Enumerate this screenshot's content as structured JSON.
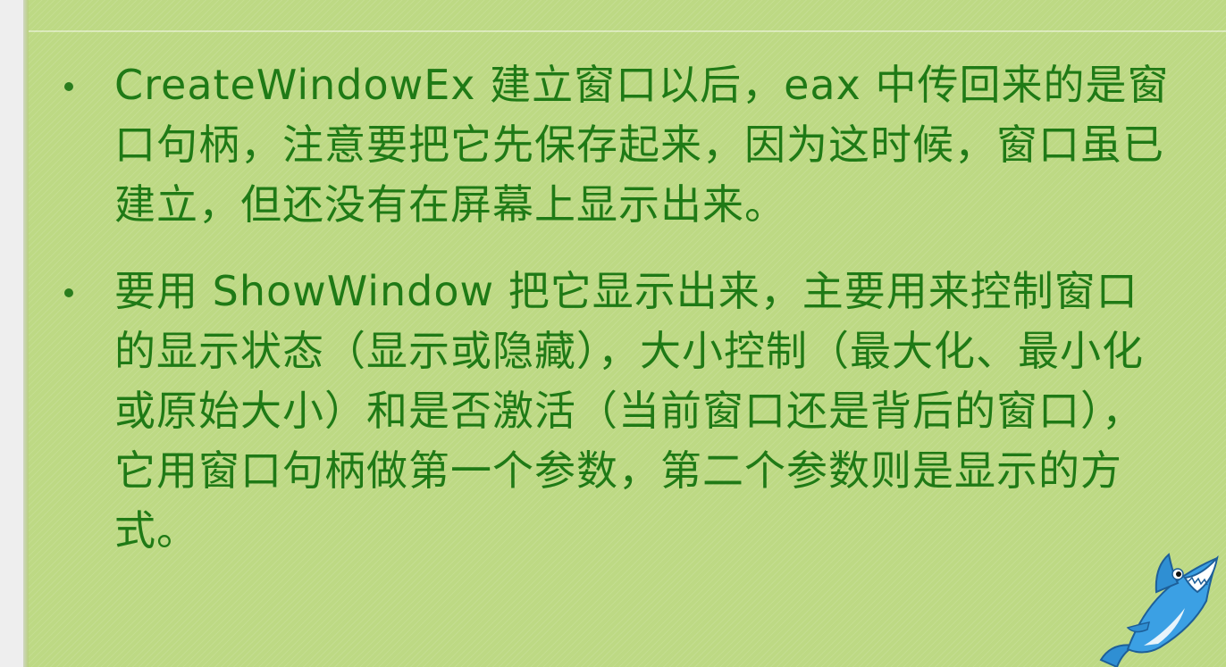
{
  "slide": {
    "bullets": [
      {
        "text": "CreateWindowEx 建立窗口以后，eax 中传回来的是窗口句柄，注意要把它先保存起来，因为这时候，窗口虽已建立，但还没有在屏幕上显示出来。"
      },
      {
        "text": "要用 ShowWindow 把它显示出来，主要用来控制窗口的显示状态（显示或隐藏），大小控制（最大化、最小化或原始大小）和是否激活（当前窗口还是背后的窗口），它用窗口句柄做第一个参数，第二个参数则是显示的方式。"
      }
    ]
  },
  "colors": {
    "background": "#bdd984",
    "text": "#1f7a16"
  },
  "icons": {
    "mascot": "shark-icon"
  }
}
